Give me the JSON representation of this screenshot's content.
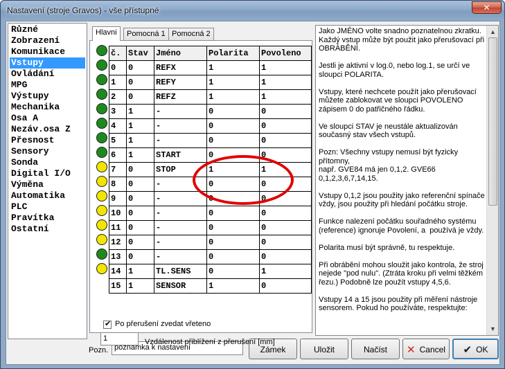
{
  "window": {
    "title": "Nastavení (stroje Gravos) - vše přístupné",
    "close_symbol": "✕"
  },
  "categories": [
    "Různé",
    "Zobrazení",
    "Komunikace",
    "Vstupy",
    "Ovládání",
    "MPG",
    "Výstupy",
    "Mechanika",
    "Osa A",
    "Nezáv.osa Z",
    "Přesnost",
    "Sensory",
    "Sonda",
    "Digital I/O",
    "Výměna",
    "Automatika",
    "PLC",
    "Pravítka",
    "Ostatní"
  ],
  "selected_category": "Vstupy",
  "tabs": [
    "Hlavni",
    "Pomocná 1",
    "Pomocná 2"
  ],
  "active_tab": "Hlavni",
  "inputs_table": {
    "headers": [
      "č.",
      "Stav",
      "Jméno",
      "Polarita",
      "Povoleno"
    ],
    "rows": [
      {
        "num": "0",
        "stav": "0",
        "jmeno": "REFX",
        "polarita": "1",
        "povoleno": "1",
        "led": "green"
      },
      {
        "num": "1",
        "stav": "0",
        "jmeno": "REFY",
        "polarita": "1",
        "povoleno": "1",
        "led": "green"
      },
      {
        "num": "2",
        "stav": "0",
        "jmeno": "REFZ",
        "polarita": "1",
        "povoleno": "1",
        "led": "green"
      },
      {
        "num": "3",
        "stav": "1",
        "jmeno": "-",
        "polarita": "0",
        "povoleno": "0",
        "led": "green"
      },
      {
        "num": "4",
        "stav": "1",
        "jmeno": "-",
        "polarita": "0",
        "povoleno": "0",
        "led": "green"
      },
      {
        "num": "5",
        "stav": "1",
        "jmeno": "-",
        "polarita": "0",
        "povoleno": "0",
        "led": "green"
      },
      {
        "num": "6",
        "stav": "1",
        "jmeno": "START",
        "polarita": "0",
        "povoleno": "0",
        "led": "green"
      },
      {
        "num": "7",
        "stav": "0",
        "jmeno": "STOP",
        "polarita": "1",
        "povoleno": "1",
        "led": "green"
      },
      {
        "num": "8",
        "stav": "0",
        "jmeno": "-",
        "polarita": "0",
        "povoleno": "0",
        "led": "yellow"
      },
      {
        "num": "9",
        "stav": "0",
        "jmeno": "-",
        "polarita": "0",
        "povoleno": "0",
        "led": "yellow"
      },
      {
        "num": "10",
        "stav": "0",
        "jmeno": "-",
        "polarita": "0",
        "povoleno": "0",
        "led": "yellow"
      },
      {
        "num": "11",
        "stav": "0",
        "jmeno": "-",
        "polarita": "0",
        "povoleno": "0",
        "led": "yellow"
      },
      {
        "num": "12",
        "stav": "0",
        "jmeno": "-",
        "polarita": "0",
        "povoleno": "0",
        "led": "yellow"
      },
      {
        "num": "13",
        "stav": "0",
        "jmeno": "-",
        "polarita": "0",
        "povoleno": "0",
        "led": "yellow"
      },
      {
        "num": "14",
        "stav": "1",
        "jmeno": "TL.SENS",
        "polarita": "0",
        "povoleno": "1",
        "led": "green"
      },
      {
        "num": "15",
        "stav": "1",
        "jmeno": "SENSOR",
        "polarita": "1",
        "povoleno": "0",
        "led": "yellow"
      }
    ]
  },
  "led_colors": {
    "green": "#1e8a1e",
    "yellow": "#f2e600"
  },
  "annotation_color": "#e00000",
  "spindle_checkbox": {
    "label": "Po přerušení zvedat vřeteno",
    "checked": true,
    "mark": "✔"
  },
  "distance": {
    "value": "1",
    "label": "Vzdálenost přiblížení z přerušení [mm]"
  },
  "help_text": "Jako JMÉNO volte snadno poznatelnou zkratku. Každý vstup může být použit jako přerušovací při OBRÁBĚNÍ.\n\nJestli je aktivní v log.0, nebo log.1, se určí ve sloupci POLARITA.\n\nVstupy, které nechcete použít jako přerušovací můžete zablokovat ve sloupci POVOLENO zápisem 0 do patřičného řádku.\n\nVe sloupci STAV je neustále aktualizován současný stav všech vstupů.\n\nPozn: Všechny vstupy nemusí být fyzicky přítomny,\nnapř. GVE84 má jen 0,1,2. GVE66 0,1,2,3,6,7,14,15.\n\nVstupy 0,1,2 jsou použity jako referenční spínače vždy, jsou použity při hledání počátku stroje.\n\nFunkce nalezení počátku souřadného systému (reference) ignoruje Povolení, a  používá je vždy.\n\nPolarita musí být správně, tu respektuje.\n\nPři obrábění mohou sloužit jako kontrola, že stroj nejede \"pod nulu\". (Ztráta kroku při velmi těžkém řezu.) Podobně lze použít vstupy 4,5,6.\n\nVstupy 14 a 15 jsou použity při měření nástroje sensorem. Pokud ho používáte, respektujte:",
  "scroll": {
    "up": "▲",
    "down": "▼"
  },
  "note": {
    "label": "Pozn.",
    "value": "poznámka k nastavení"
  },
  "buttons": {
    "lock": "Zámek",
    "save": "Uložit",
    "load": "Načíst",
    "cancel": "Cancel",
    "cancel_icon": "✕",
    "ok": "OK",
    "ok_icon": "✔"
  }
}
